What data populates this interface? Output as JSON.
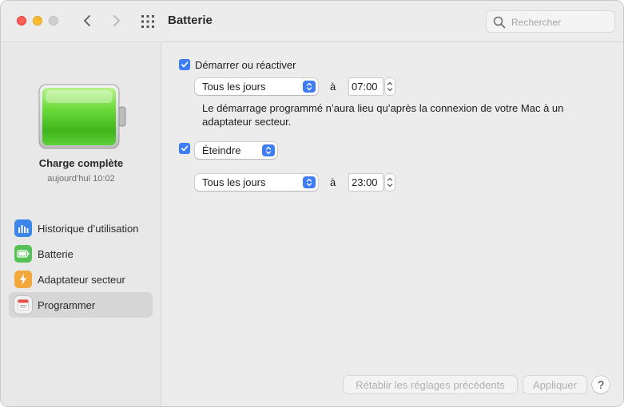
{
  "window": {
    "title": "Batterie",
    "search_placeholder": "Rechercher"
  },
  "sidebar": {
    "status_title": "Charge complète",
    "status_time": "aujourd’hui 10:02",
    "items": [
      {
        "label": "Historique d’utilisation",
        "icon": "bar-chart-icon",
        "color": "#3d86e9"
      },
      {
        "label": "Batterie",
        "icon": "battery-icon",
        "color": "#55c156"
      },
      {
        "label": "Adaptateur secteur",
        "icon": "lightning-icon",
        "color": "#f3a83b"
      },
      {
        "label": "Programmer",
        "icon": "calendar-icon",
        "color": "#f0f0f0",
        "selected": true
      }
    ]
  },
  "schedule": {
    "startup": {
      "checkbox_label": "Démarrer ou réactiver",
      "checked": true,
      "frequency": "Tous les jours",
      "at_label": "à",
      "time": "07:00"
    },
    "note": "Le démarrage programmé n’aura lieu qu’après la connexion de votre Mac à un adaptateur secteur.",
    "shutdown": {
      "checked": true,
      "action": "Éteindre",
      "frequency": "Tous les jours",
      "at_label": "à",
      "time": "23:00"
    }
  },
  "footer": {
    "restore_label": "Rétablir les réglages précédents",
    "apply_label": "Appliquer",
    "help_label": "?"
  },
  "colors": {
    "accent": "#3e7df5",
    "close": "#ff5f57",
    "minimize": "#febc2e"
  }
}
